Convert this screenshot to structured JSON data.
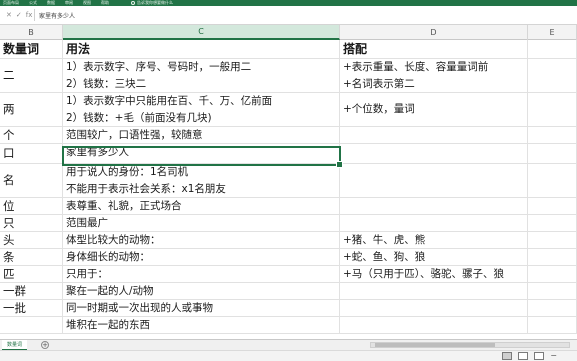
{
  "ribbon": {
    "tabs": [
      "页面布局",
      "公式",
      "数据",
      "审阅",
      "视图",
      "帮助"
    ],
    "tell_me": "告诉我你想要做什么"
  },
  "formula_bar": {
    "cancel_icon": "✕",
    "enter_icon": "✓",
    "fx_icon": "fx",
    "content": "家里有多少人"
  },
  "columns": {
    "b": "B",
    "c": "C",
    "d": "D",
    "e": "E"
  },
  "header": {
    "b": "数量词",
    "c": "用法",
    "d": "搭配"
  },
  "rows": [
    {
      "b": "二",
      "c": [
        "1）表示数字、序号、号码时，一般用二",
        "2）钱数：三块二"
      ],
      "d": [
        "+表示重量、长度、容量量词前",
        "+名词表示第二"
      ]
    },
    {
      "b": "两",
      "c": [
        "1）表示数字中只能用在百、千、万、亿前面",
        "2）钱数：+毛（前面没有几块)"
      ],
      "d": [
        "+个位数，量词"
      ]
    },
    {
      "b": "个",
      "c": [
        "范围较广，口语性强，较随意"
      ],
      "d": [
        ""
      ]
    },
    {
      "b": "口",
      "c": [
        "家里有多少人"
      ],
      "d": [
        ""
      ]
    },
    {
      "b": "名",
      "c": [
        "用于说人的身份：1名司机",
        "不能用于表示社会关系：x1名朋友"
      ],
      "d": [
        ""
      ]
    },
    {
      "b": "位",
      "c": [
        "表尊重、礼貌，正式场合"
      ],
      "d": [
        ""
      ]
    },
    {
      "b": "只",
      "c": [
        "范围最广"
      ],
      "d": [
        ""
      ]
    },
    {
      "b": "头",
      "c": [
        "体型比较大的动物："
      ],
      "d": [
        "+猪、牛、虎、熊"
      ]
    },
    {
      "b": "条",
      "c": [
        "身体细长的动物："
      ],
      "d": [
        "+蛇、鱼、狗、狼"
      ]
    },
    {
      "b": "匹",
      "c": [
        "只用于："
      ],
      "d": [
        "+马（只用于匹）、骆驼、骡子、狼"
      ]
    },
    {
      "b": "一群",
      "c": [
        "聚在一起的人/动物"
      ],
      "d": [
        ""
      ]
    },
    {
      "b": "一批",
      "c": [
        "同一时期或一次出现的人或事物"
      ],
      "d": [
        ""
      ]
    },
    {
      "b": "",
      "c": [
        "堆积在一起的东西"
      ],
      "d": [
        ""
      ]
    }
  ],
  "sheet_tabs": {
    "active": "数量词",
    "add_icon": "+"
  },
  "colors": {
    "accent": "#217346",
    "gridline": "#e1e1e1"
  }
}
